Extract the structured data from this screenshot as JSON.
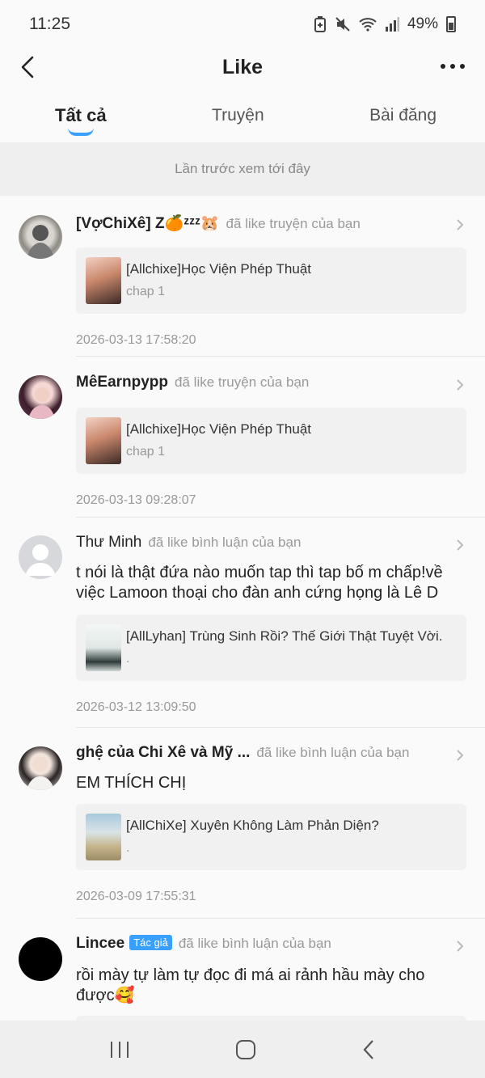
{
  "status_bar": {
    "time": "11:25",
    "battery": "49%",
    "icons": [
      "battery-saver-icon",
      "mute-icon",
      "wifi-icon",
      "signal-icon",
      "battery-icon"
    ]
  },
  "header": {
    "title": "Like",
    "back_icon": "chevron-left-icon",
    "more_icon": "more-horizontal-icon"
  },
  "tabs": [
    {
      "label": "Tất cả",
      "active": true
    },
    {
      "label": "Truyện",
      "active": false
    },
    {
      "label": "Bài đăng",
      "active": false
    }
  ],
  "last_viewed_label": "Lần trước xem tới đây",
  "items": [
    {
      "user": "[VợChiXê] Z🍊ᶻᶻᶻ🐹",
      "action": "đã like truyện của bạn",
      "story_title": "[Allchixe]Học Viện Phép Thuật",
      "story_sub": "chap 1",
      "timestamp": "2026-03-13 17:58:20"
    },
    {
      "user": "MêEarnpypp",
      "action": "đã like truyện của bạn",
      "story_title": "[Allchixe]Học Viện Phép Thuật",
      "story_sub": "chap 1",
      "timestamp": "2026-03-13 09:28:07"
    },
    {
      "user": "Thư Minh",
      "action": "đã like bình luận của bạn",
      "comment_line1": "t nói là thật đứa nào muốn tap thì tap bố m  chấp!về",
      "comment_line2": "việc Lamoon thoại cho đàn anh cứng họng là Lê D",
      "story_title": "[AllLyhan] Trùng Sinh Rồi? Thế Giới Thật Tuyệt Vời.",
      "story_sub": ".",
      "timestamp": "2026-03-12 13:09:50"
    },
    {
      "user": "ghệ của Chi Xê và Mỹ ...",
      "action": "đã like bình luận của bạn",
      "comment_line1": "EM THÍCH CHỊ",
      "story_title": "[AllChiXe] Xuyên Không Làm Phản Diện?",
      "story_sub": ".",
      "timestamp": "2026-03-09 17:55:31"
    },
    {
      "user": "Lincee",
      "badge": "Tác giả",
      "action": "đã like bình luận của bạn",
      "comment_line1": "rồi mày tự làm tự đọc đi má ai rảnh hầu mày cho",
      "comment_line2": "được🥰"
    }
  ],
  "colors": {
    "accent": "#3aa0ff",
    "background": "#fbfafa",
    "card": "#f1f1f2"
  },
  "nav_bar": {
    "icons": [
      "recent-apps-icon",
      "home-icon",
      "back-nav-icon"
    ]
  }
}
